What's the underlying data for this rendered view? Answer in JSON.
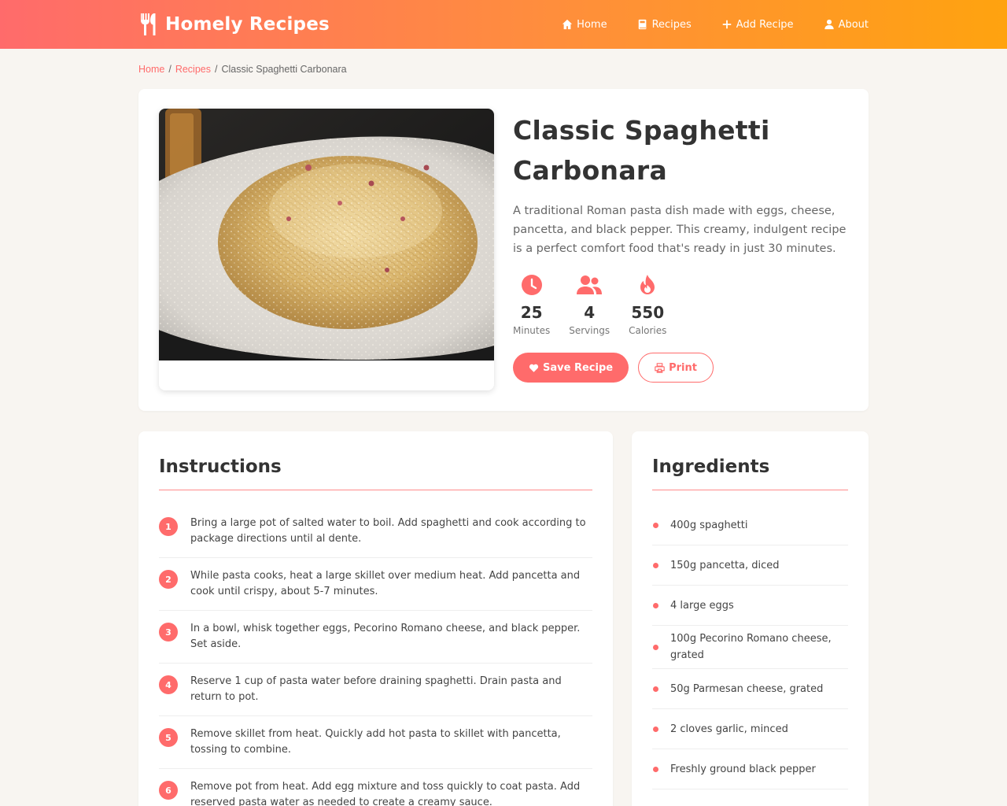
{
  "header": {
    "brand": "Homely Recipes",
    "nav": [
      {
        "label": "Home",
        "icon": "home-icon"
      },
      {
        "label": "Recipes",
        "icon": "book-icon"
      },
      {
        "label": "Add Recipe",
        "icon": "plus-icon"
      },
      {
        "label": "About",
        "icon": "user-icon"
      }
    ]
  },
  "breadcrumb": {
    "home": "Home",
    "recipes": "Recipes",
    "current": "Classic Spaghetti Carbonara",
    "separator": "/"
  },
  "recipe": {
    "title": "Classic Spaghetti Carbonara",
    "description": "A traditional Roman pasta dish made with eggs, cheese, pancetta, and black pepper. This creamy, indulgent recipe is a perfect comfort food that's ready in just 30 minutes.",
    "stats": [
      {
        "value": "25",
        "label": "Minutes",
        "icon": "clock-icon"
      },
      {
        "value": "4",
        "label": "Servings",
        "icon": "users-icon"
      },
      {
        "value": "550",
        "label": "Calories",
        "icon": "fire-icon"
      }
    ],
    "save_label": "Save Recipe",
    "print_label": "Print"
  },
  "instructions": {
    "title": "Instructions",
    "steps": [
      {
        "num": "1",
        "text": "Bring a large pot of salted water to boil. Add spaghetti and cook according to package directions until al dente."
      },
      {
        "num": "2",
        "text": "While pasta cooks, heat a large skillet over medium heat. Add pancetta and cook until crispy, about 5-7 minutes."
      },
      {
        "num": "3",
        "text": "In a bowl, whisk together eggs, Pecorino Romano cheese, and black pepper. Set aside."
      },
      {
        "num": "4",
        "text": "Reserve 1 cup of pasta water before draining spaghetti. Drain pasta and return to pot."
      },
      {
        "num": "5",
        "text": "Remove skillet from heat. Quickly add hot pasta to skillet with pancetta, tossing to combine."
      },
      {
        "num": "6",
        "text": "Remove pot from heat. Add egg mixture and toss quickly to coat pasta. Add reserved pasta water as needed to create a creamy sauce."
      }
    ]
  },
  "ingredients": {
    "title": "Ingredients",
    "items": [
      "400g spaghetti",
      "150g pancetta, diced",
      "4 large eggs",
      "100g Pecorino Romano cheese, grated",
      "50g Parmesan cheese, grated",
      "2 cloves garlic, minced",
      "Freshly ground black pepper"
    ]
  },
  "colors": {
    "accent": "#ff6b6b",
    "header_gradient_start": "#ff6b6b",
    "header_gradient_end": "#ffa30f",
    "background": "#f8f5f1"
  }
}
